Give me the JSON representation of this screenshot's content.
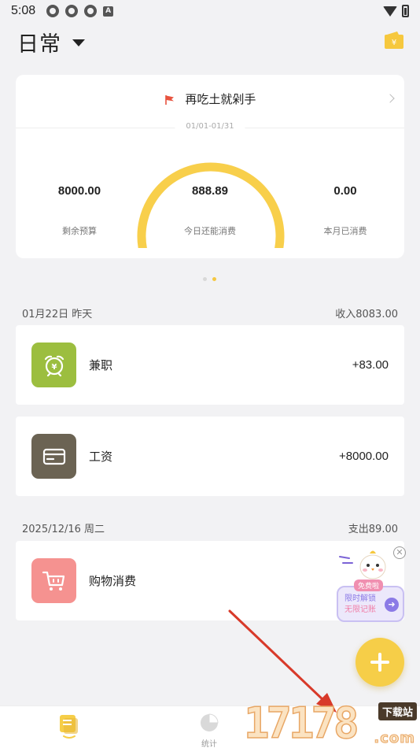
{
  "status_bar": {
    "time": "5:08",
    "a_icon": "A"
  },
  "header": {
    "title": "日常"
  },
  "budget": {
    "name": "再吃土就剁手",
    "period": "01/01-01/31",
    "left_value": "8000.00",
    "left_label": "剩余预算",
    "center_value": "888.89",
    "center_label": "今日还能消费",
    "right_value": "0.00",
    "right_label": "本月已消费",
    "gauge_fraction": 0.98
  },
  "groups": [
    {
      "date": "01月22日 昨天",
      "summary": "收入8083.00",
      "entries": [
        {
          "label": "兼职",
          "amount": "+83.00",
          "icon": "alarm-clock-yen-icon",
          "color": "#9cbe3f"
        },
        {
          "label": "工资",
          "amount": "+8000.00",
          "icon": "card-icon",
          "color": "#6b6353"
        }
      ]
    },
    {
      "date": "2025/12/16 周二",
      "summary": "支出89.00",
      "entries": [
        {
          "label": "购物消费",
          "amount": "",
          "icon": "shopping-cart-icon",
          "color": "#f59290"
        }
      ]
    }
  ],
  "promo": {
    "badge": "免费啦",
    "line1": "限时解锁",
    "line2": "无限记账"
  },
  "tabs": [
    {
      "label": "",
      "icon": "ledger-icon"
    },
    {
      "label": "统计",
      "icon": "pie-chart-icon"
    }
  ],
  "watermark": {
    "number": "17178",
    "tag": "下载站",
    "suffix": ".com"
  },
  "colors": {
    "accent": "#f6ce48",
    "background": "#f2f2f4",
    "card": "#ffffff",
    "arrow": "#d83a2a"
  }
}
